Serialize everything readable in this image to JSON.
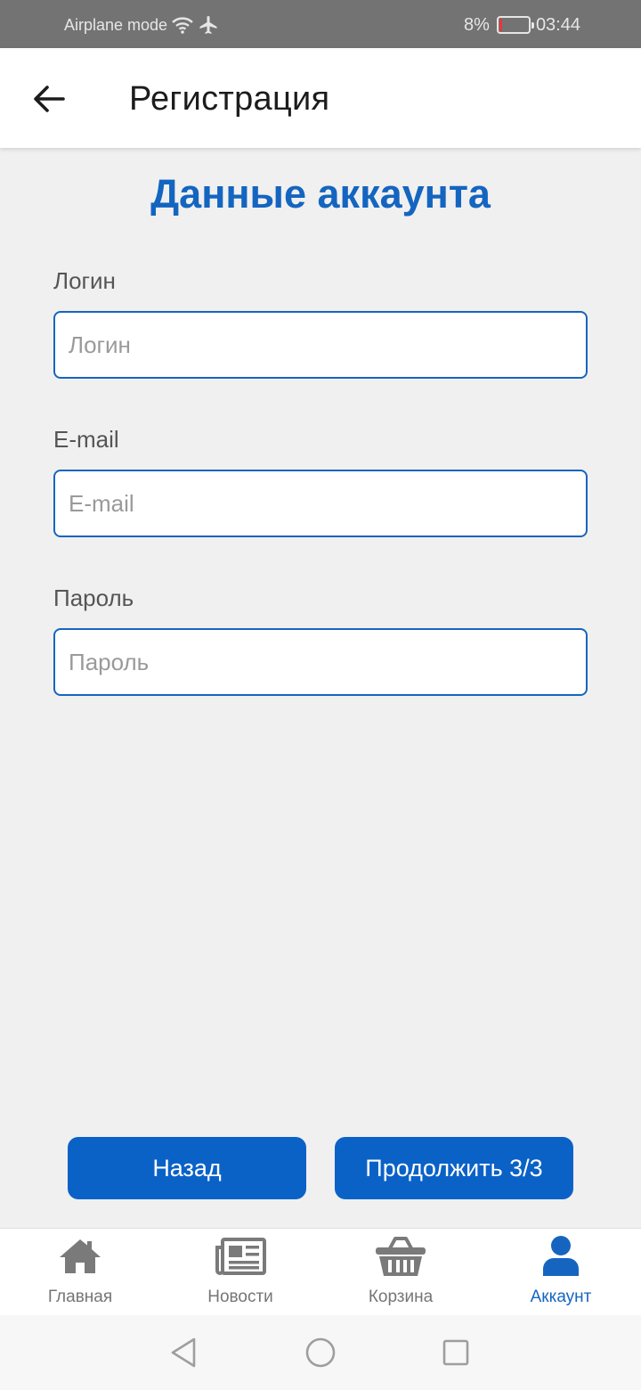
{
  "status_bar": {
    "airplane_text": "Airplane mode",
    "battery_percent": "8%",
    "time": "03:44",
    "battery_level": 0.08,
    "icons": [
      "wifi-icon",
      "airplane-icon",
      "battery-icon"
    ]
  },
  "app_bar": {
    "title": "Регистрация",
    "back_icon": "arrow-left-icon"
  },
  "form": {
    "section_title": "Данные аккаунта",
    "login": {
      "label": "Логин",
      "placeholder": "Логин",
      "value": ""
    },
    "email": {
      "label": "E-mail",
      "placeholder": "E-mail",
      "value": ""
    },
    "password": {
      "label": "Пароль",
      "placeholder": "Пароль",
      "value": ""
    }
  },
  "actions": {
    "back_label": "Назад",
    "continue_label": "Продолжить 3/3"
  },
  "bottom_nav": {
    "items": [
      {
        "label": "Главная",
        "icon": "home-icon",
        "active": false
      },
      {
        "label": "Новости",
        "icon": "newspaper-icon",
        "active": false
      },
      {
        "label": "Корзина",
        "icon": "basket-icon",
        "active": false
      },
      {
        "label": "Аккаунт",
        "icon": "user-icon",
        "active": true
      }
    ]
  },
  "system_nav": {
    "icons": [
      "back-triangle-icon",
      "home-circle-icon",
      "recents-square-icon"
    ]
  },
  "colors": {
    "accent": "#1565c0",
    "button": "#0a62c7",
    "background": "#f0f0f0",
    "status_bar": "#737373",
    "inactive_nav": "#757575",
    "battery_low": "#e53935"
  }
}
